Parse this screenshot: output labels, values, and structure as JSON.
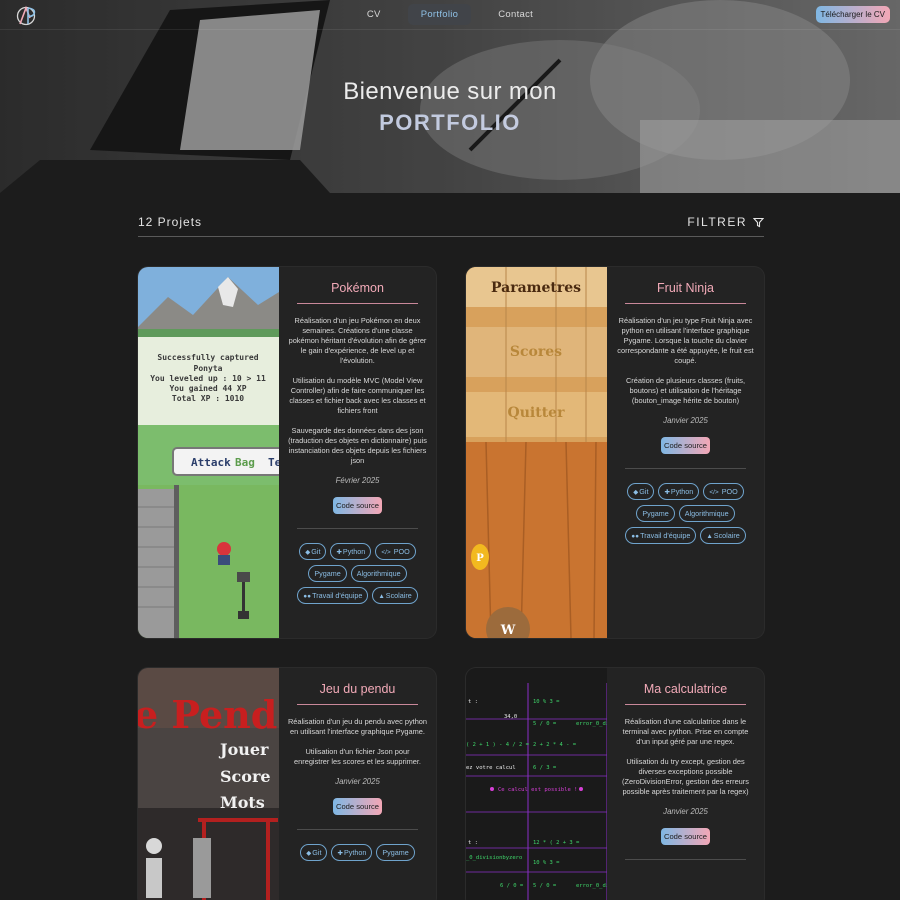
{
  "nav": {
    "logo_text": "AP",
    "links": [
      "CV",
      "Portfolio",
      "Contact"
    ],
    "cv_button": "Télécharger le CV"
  },
  "hero": {
    "line1": "Bienvenue sur mon",
    "line2": "PORTFOLIO"
  },
  "toolbar": {
    "count": "12 Projets",
    "filter_label": "FILTRER"
  },
  "projects": [
    {
      "title": "Pokémon",
      "desc": [
        "Réalisation d'un jeu Pokémon en deux semaines. Créations d'une classe pokémon héritant d'évolution afin de gérer le gain d'expérience, de level up et l'évolution.",
        "Utilisation du modèle MVC (Model View Controller) afin de faire communiquer les classes et fichier back avec les classes et fichiers front",
        "Sauvegarde des données dans des json (traduction des objets en dictionnaire) puis instanciation des objets depuis les fichiers json"
      ],
      "date": "Février 2025",
      "source_label": "Code source",
      "tags": [
        "Git",
        "Python",
        "POO",
        "Pygame",
        "Algorithmique",
        "Travail d'équipe",
        "Scolaire"
      ],
      "image_text": {
        "captured": "Successfully captured",
        "name": "Ponyta",
        "level": "You leveled up : 10 > 11",
        "gained": "You gained 44 XP",
        "total": "Total XP : 1010",
        "attack": "Attack",
        "bag": "Bag",
        "team": "Te"
      }
    },
    {
      "title": "Fruit Ninja",
      "desc": [
        "Réalisation d'un jeu type Fruit Ninja avec python en utilisant l'interface graphique Pygame. Lorsque la touche du clavier correspondante a été appuyée, le fruit est coupé.",
        "Création de plusieurs classes (fruits, boutons) et utilisation de l'héritage (bouton_image hérite de bouton)"
      ],
      "date": "Janvier 2025",
      "source_label": "Code source",
      "tags": [
        "Git",
        "Python",
        "POO",
        "Pygame",
        "Algorithmique",
        "Travail d'équipe",
        "Scolaire"
      ],
      "image_text": {
        "parametres": "Parametres",
        "scores": "Scores",
        "quitter": "Quitter",
        "p": "P",
        "w": "W"
      }
    },
    {
      "title": "Jeu du pendu",
      "desc": [
        "Réalisation d'un jeu du pendu avec python en utilisant l'interface graphique Pygame.",
        "Utilisation d'un fichier Json pour enregistrer les scores et les supprimer."
      ],
      "date": "Janvier 2025",
      "source_label": "Code source",
      "tags": [
        "Git",
        "Python",
        "Pygame"
      ],
      "image_text": {
        "title": "e Pend",
        "jouer": "Jouer",
        "score": "Score",
        "mots": "Mots"
      }
    },
    {
      "title": "Ma calculatrice",
      "desc": [
        "Réalisation d'une calculatrice dans le terminal avec python. Prise en compte d'un input géré par une regex.",
        "Utilisation du try except, gestion des diverses exceptions possible (ZeroDivisionError, gestion des erreurs possible après traitement par la regex)"
      ],
      "date": "Janvier 2025",
      "source_label": "Code source",
      "tags": [],
      "image_text": {
        "l1a": "t :",
        "l1b": "10 % 3 =",
        "l2a": "34,0",
        "l2b": "5 / 0 =",
        "l2c": "error_0_div",
        "l3a": "( 2 + 1 ) - 4 / 2 =",
        "l3b": "2 + 2 * 4 - =",
        "l4a": "ez votre calcul",
        "l4b": "6 / 3 =",
        "l5": "Ce calcul est possible !",
        "l6a": "t :",
        "l6b": "12 * ( 2 + 3 =",
        "l7a": "_0_divisionbyzero",
        "l7b": "10 % 3 =",
        "l8a": "6 / 0 =",
        "l8b": "5 / 0 =",
        "l8c": "error_0_div"
      }
    }
  ],
  "colors": {
    "accent_blue": "#8fc1e6",
    "accent_pink": "#f2aab8",
    "background": "#1c1c1c",
    "card": "#232323"
  },
  "icons": {
    "filter": "funnel-icon",
    "git": "git-icon",
    "python": "python-icon",
    "poo": "code-icon",
    "team": "users-icon",
    "school": "graduation-cap-icon"
  }
}
